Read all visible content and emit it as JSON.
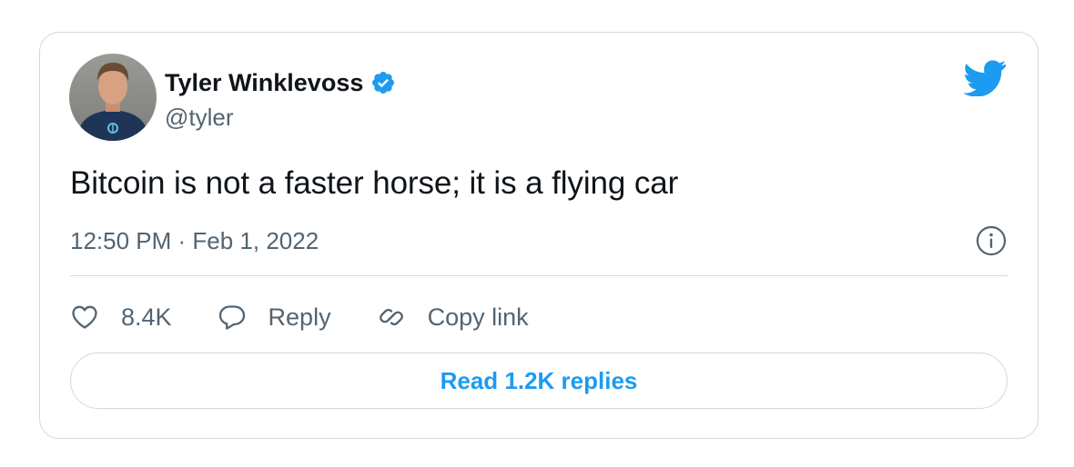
{
  "author": {
    "display_name": "Tyler Winklevoss",
    "handle": "@tyler",
    "verified": true
  },
  "tweet": {
    "text": "Bitcoin is not a faster horse; it is a flying car",
    "timestamp": "12:50 PM · Feb 1, 2022"
  },
  "actions": {
    "like_count": "8.4K",
    "reply_label": "Reply",
    "copy_link_label": "Copy link"
  },
  "read_replies_label": "Read 1.2K replies",
  "icons": {
    "brand": "twitter-bird-icon",
    "verified": "verified-badge-icon",
    "info": "info-icon",
    "like": "heart-icon",
    "reply": "speech-bubble-icon",
    "copy_link": "link-icon"
  },
  "colors": {
    "brand_blue": "#1d9bf0",
    "text_primary": "#0f1419",
    "text_secondary": "#536471",
    "border": "#cfd9de"
  }
}
